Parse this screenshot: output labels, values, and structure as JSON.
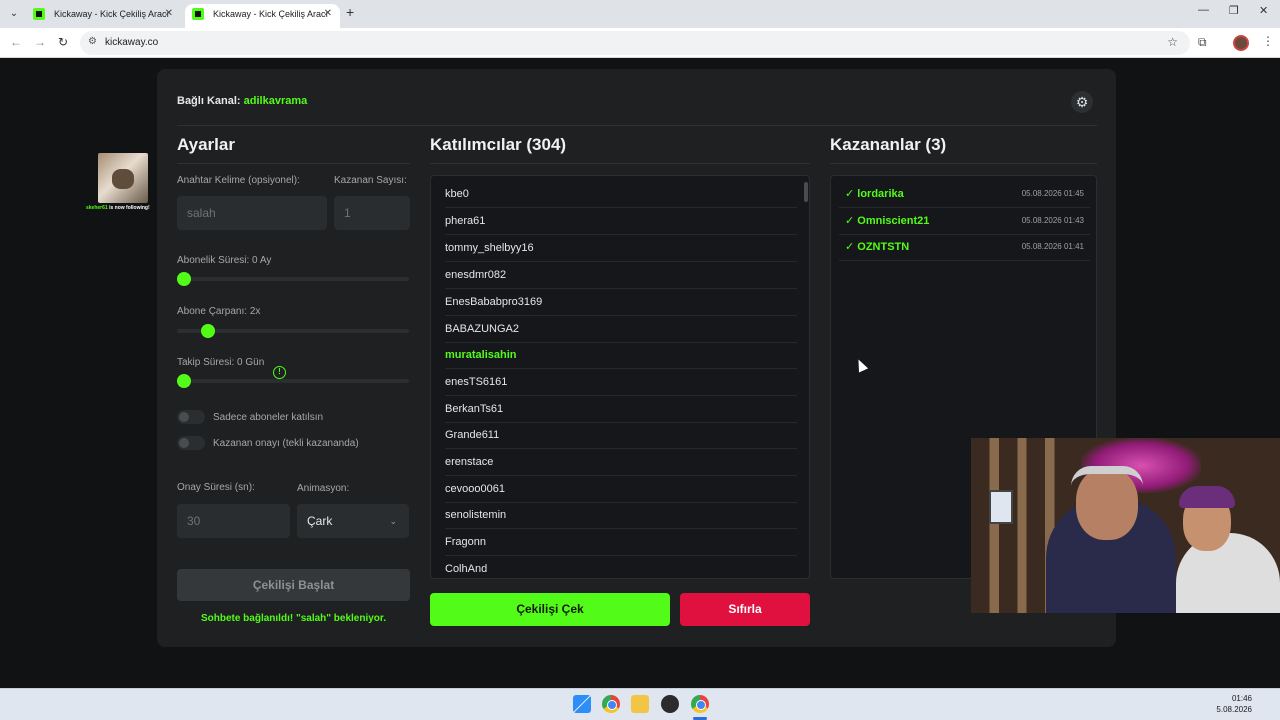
{
  "browser": {
    "tabs": [
      {
        "title": "Kickaway - Kick Çekiliş Aracı",
        "active": false
      },
      {
        "title": "Kickaway - Kick Çekiliş Aracı",
        "active": true
      }
    ],
    "url": "kickaway.co"
  },
  "header": {
    "channel_label": "Bağlı Kanal:",
    "channel_name": "adilkavrama"
  },
  "settings": {
    "title": "Ayarlar",
    "keyword_label": "Anahtar Kelime (opsiyonel):",
    "keyword_placeholder": "salah",
    "winner_count_label": "Kazanan Sayısı:",
    "winner_count_placeholder": "1",
    "sub_duration_label": "Abonelik Süresi: 0 Ay",
    "sub_duration_value": 0,
    "sub_multiplier_label": "Abone Çarpanı: 2x",
    "sub_multiplier_value": 2,
    "follow_duration_label": "Takip Süresi:  0  Gün",
    "follow_duration_value": 0,
    "toggle_subs_only": "Sadece aboneler katılsın",
    "toggle_winner_confirm": "Kazanan onayı (tekli kazananda)",
    "confirm_time_label": "Onay Süresi (sn):",
    "confirm_time_placeholder": "30",
    "animation_label": "Animasyon:",
    "animation_value": "Çark",
    "start_button": "Çekilişi Başlat",
    "status": "Sohbete bağlanıldı! \"salah\" bekleniyor."
  },
  "participants": {
    "title": "Katılımcılar (304)",
    "items": [
      {
        "name": "kbe0",
        "highlight": false
      },
      {
        "name": "phera61",
        "highlight": false
      },
      {
        "name": "tommy_shelbyy16",
        "highlight": false
      },
      {
        "name": "enesdmr082",
        "highlight": false
      },
      {
        "name": "EnesBababpro3169",
        "highlight": false
      },
      {
        "name": "BABAZUNGA2",
        "highlight": false
      },
      {
        "name": "muratalisahin",
        "highlight": true
      },
      {
        "name": "enesTS6161",
        "highlight": false
      },
      {
        "name": "BerkanTs61",
        "highlight": false
      },
      {
        "name": "Grande611",
        "highlight": false
      },
      {
        "name": "erenstace",
        "highlight": false
      },
      {
        "name": "cevooo0061",
        "highlight": false
      },
      {
        "name": "senolistemin",
        "highlight": false
      },
      {
        "name": "Fragonn",
        "highlight": false
      },
      {
        "name": "ColhAnd",
        "highlight": false
      }
    ]
  },
  "winners": {
    "title": "Kazananlar (3)",
    "items": [
      {
        "name": "✓ lordarika",
        "time": "05.08.2026 01:45"
      },
      {
        "name": "✓ Omniscient21",
        "time": "05.08.2026 01:43"
      },
      {
        "name": "✓ OZNTSTN",
        "time": "05.08.2026 01:41"
      }
    ]
  },
  "actions": {
    "draw_button": "Çekilişi Çek",
    "reset_button": "Sıfırla"
  },
  "overlay": {
    "alert_user": "skeher61",
    "alert_text": " is now following!"
  },
  "taskbar": {
    "time": "01:46",
    "date": "5.08.2026"
  },
  "colors": {
    "accent": "#53fc18",
    "danger": "#e0113f",
    "card": "#1e2022"
  }
}
